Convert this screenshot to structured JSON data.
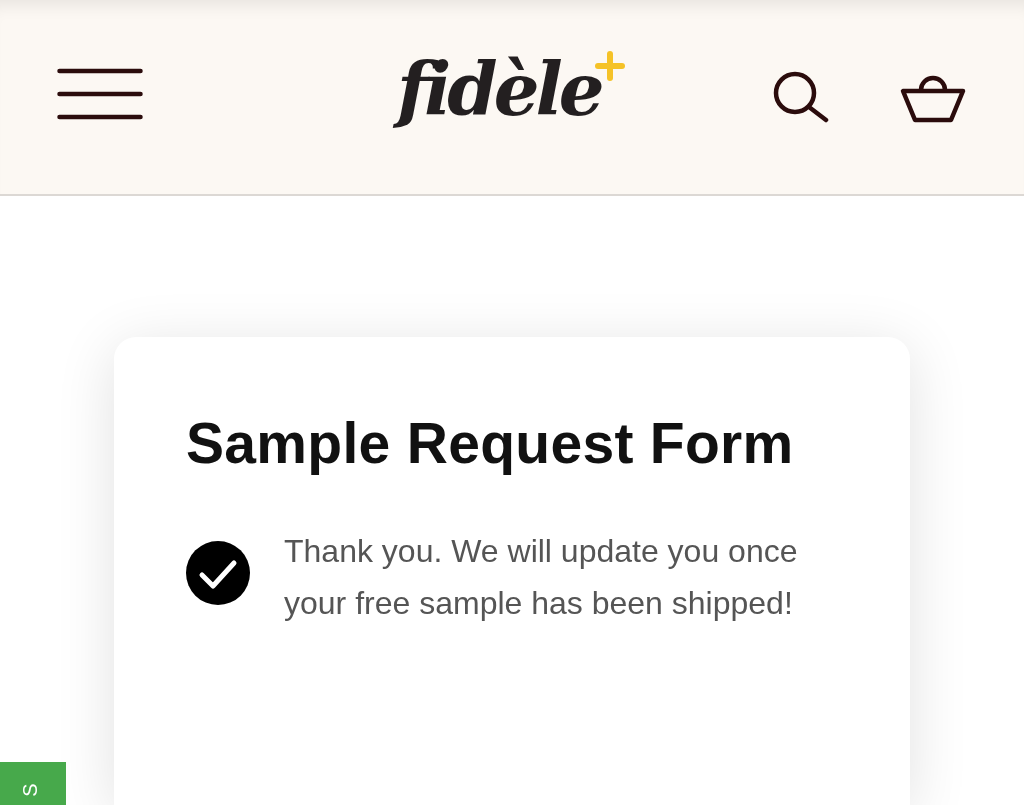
{
  "header": {
    "logo": "fidèle"
  },
  "card": {
    "title": "Sample Request Form",
    "message": "Thank you. We will update you once your free sample has been shipped!"
  },
  "side_tab": {
    "label": "S"
  }
}
